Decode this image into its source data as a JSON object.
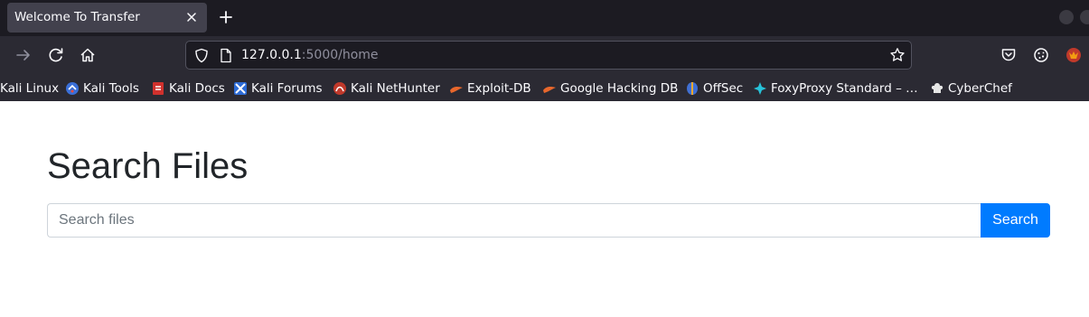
{
  "tab": {
    "title": "Welcome To Transfer"
  },
  "url": {
    "host": "127.0.0.1",
    "rest": ":5000/home"
  },
  "bookmarks": [
    {
      "label": "Kali Linux",
      "icon": "kali-linux-icon"
    },
    {
      "label": "Kali Tools",
      "icon": "kali-tools-icon"
    },
    {
      "label": "Kali Docs",
      "icon": "kali-docs-icon"
    },
    {
      "label": "Kali Forums",
      "icon": "kali-forums-icon"
    },
    {
      "label": "Kali NetHunter",
      "icon": "kali-nethunter-icon"
    },
    {
      "label": "Exploit-DB",
      "icon": "exploit-db-icon"
    },
    {
      "label": "Google Hacking DB",
      "icon": "google-hacking-db-icon"
    },
    {
      "label": "OffSec",
      "icon": "offsec-icon"
    },
    {
      "label": "FoxyProxy Standard – …",
      "icon": "foxyproxy-icon"
    },
    {
      "label": "CyberChef",
      "icon": "cyberchef-icon"
    }
  ],
  "page": {
    "title": "Search Files",
    "search_placeholder": "Search files",
    "search_value": "",
    "search_button": "Search"
  },
  "colors": {
    "accent": "#007bff",
    "browser_chrome": "#2b2a33",
    "tabstrip": "#1c1b22"
  }
}
